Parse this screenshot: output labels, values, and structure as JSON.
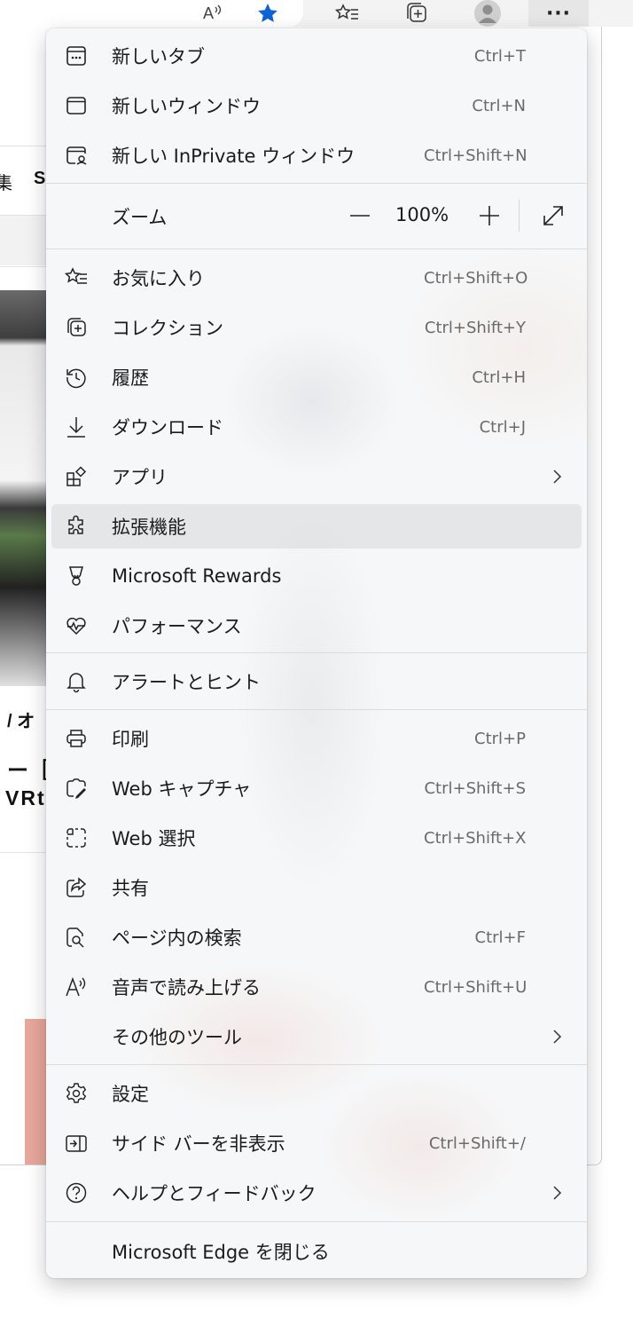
{
  "browser": {
    "page_fragments": {
      "left_char": "集",
      "s_char": "S",
      "slash_text": "/ オ",
      "dash_text": "ー［",
      "vr_text": "VRt"
    }
  },
  "menu": {
    "items": [
      {
        "label": "新しいタブ",
        "shortcut": "Ctrl+T"
      },
      {
        "label": "新しいウィンドウ",
        "shortcut": "Ctrl+N"
      },
      {
        "label": "新しい InPrivate ウィンドウ",
        "shortcut": "Ctrl+Shift+N"
      }
    ],
    "zoom": {
      "label": "ズーム",
      "value": "100%"
    },
    "group2": [
      {
        "label": "お気に入り",
        "shortcut": "Ctrl+Shift+O"
      },
      {
        "label": "コレクション",
        "shortcut": "Ctrl+Shift+Y"
      },
      {
        "label": "履歴",
        "shortcut": "Ctrl+H"
      },
      {
        "label": "ダウンロード",
        "shortcut": "Ctrl+J"
      },
      {
        "label": "アプリ",
        "shortcut": ""
      },
      {
        "label": "拡張機能",
        "shortcut": ""
      },
      {
        "label": "Microsoft Rewards",
        "shortcut": ""
      },
      {
        "label": "パフォーマンス",
        "shortcut": ""
      }
    ],
    "alerts": {
      "label": "アラートとヒント"
    },
    "group3": [
      {
        "label": "印刷",
        "shortcut": "Ctrl+P"
      },
      {
        "label": "Web キャプチャ",
        "shortcut": "Ctrl+Shift+S"
      },
      {
        "label": "Web 選択",
        "shortcut": "Ctrl+Shift+X"
      },
      {
        "label": "共有",
        "shortcut": ""
      },
      {
        "label": "ページ内の検索",
        "shortcut": "Ctrl+F"
      },
      {
        "label": "音声で読み上げる",
        "shortcut": "Ctrl+Shift+U"
      },
      {
        "label": "その他のツール",
        "shortcut": ""
      }
    ],
    "group4": [
      {
        "label": "設定",
        "shortcut": ""
      },
      {
        "label": "サイド バーを非表示",
        "shortcut": "Ctrl+Shift+/"
      },
      {
        "label": "ヘルプとフィードバック",
        "shortcut": ""
      }
    ],
    "close": {
      "label": "Microsoft Edge を閉じる"
    }
  }
}
